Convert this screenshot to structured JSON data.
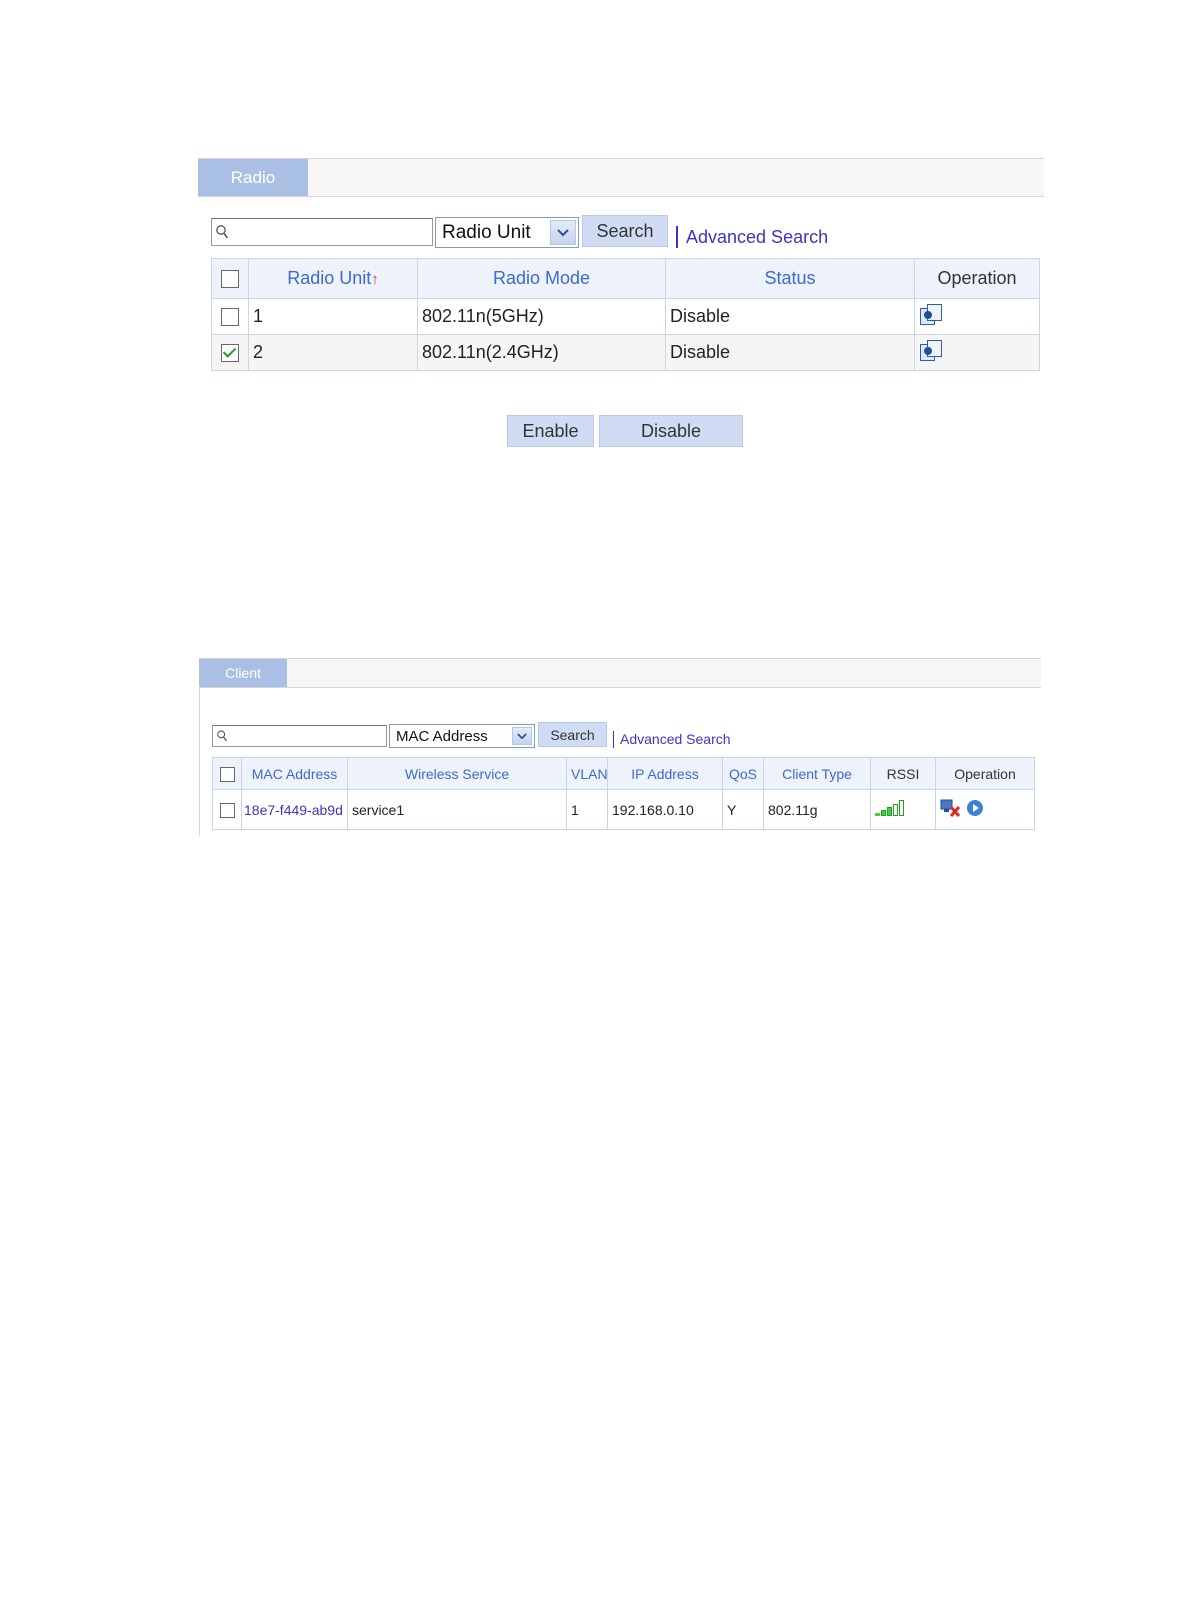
{
  "radio_panel": {
    "tab_label": "Radio",
    "search": {
      "placeholder": "",
      "field_select": "Radio Unit",
      "search_button": "Search",
      "advanced_link": "Advanced Search"
    },
    "columns": [
      "Radio Unit",
      "Radio Mode",
      "Status",
      "Operation"
    ],
    "sort_indicator": "↑",
    "rows": [
      {
        "checked": false,
        "radio_unit": "1",
        "radio_mode": "802.11n(5GHz)",
        "status": "Disable",
        "operation_icon": "configure-icon"
      },
      {
        "checked": true,
        "radio_unit": "2",
        "radio_mode": "802.11n(2.4GHz)",
        "status": "Disable",
        "operation_icon": "configure-icon"
      }
    ],
    "buttons": {
      "enable": "Enable",
      "disable": "Disable"
    }
  },
  "client_panel": {
    "tab_label": "Client",
    "search": {
      "placeholder": "",
      "field_select": "MAC Address",
      "search_button": "Search",
      "advanced_link": "Advanced Search"
    },
    "columns": [
      "MAC Address",
      "Wireless Service",
      "VLAN",
      "IP Address",
      "QoS",
      "Client Type",
      "RSSI",
      "Operation"
    ],
    "rows": [
      {
        "checked": false,
        "mac": "18e7-f449-ab9d",
        "service": "service1",
        "vlan": "1",
        "ip": "192.168.0.10",
        "qos": "Y",
        "client_type": "802.11g",
        "rssi_bars": 4,
        "operation_icons": [
          "disconnect-icon",
          "play-icon"
        ]
      }
    ]
  },
  "colors": {
    "tab": "#a9c0e4",
    "link": "#3a35c8",
    "header_text": "#3c6ad3",
    "button": "#cfdcf4"
  }
}
